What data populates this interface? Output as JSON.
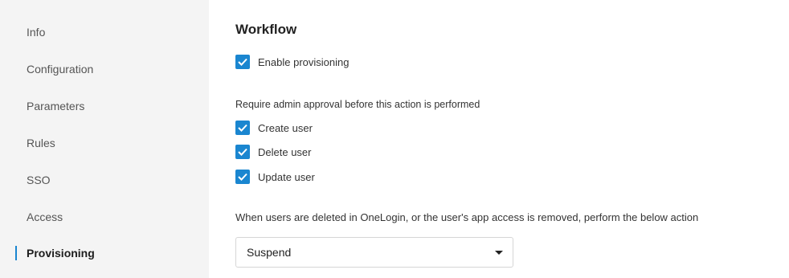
{
  "sidebar": {
    "items": [
      {
        "label": "Info"
      },
      {
        "label": "Configuration"
      },
      {
        "label": "Parameters"
      },
      {
        "label": "Rules"
      },
      {
        "label": "SSO"
      },
      {
        "label": "Access"
      },
      {
        "label": "Provisioning"
      }
    ],
    "active_item": "Provisioning"
  },
  "main": {
    "title": "Workflow",
    "enable_provisioning": {
      "label": "Enable provisioning",
      "checked": true
    },
    "approval_text": "Require admin approval before this action is performed",
    "approval_options": [
      {
        "label": "Create user",
        "checked": true
      },
      {
        "label": "Delete user",
        "checked": true
      },
      {
        "label": "Update user",
        "checked": true
      }
    ],
    "deletion_text": "When users are deleted in OneLogin, or the user's app access is removed, perform the below action",
    "deletion_action": {
      "selected": "Suspend"
    }
  },
  "colors": {
    "accent": "#1a86d0",
    "sidebar_bg": "#f4f4f4",
    "main_bg": "#ffffff"
  },
  "icons": {
    "checkbox": "check-icon",
    "select": "chevron-down-icon"
  }
}
